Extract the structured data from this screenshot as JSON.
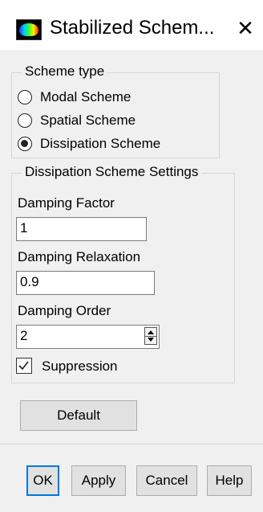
{
  "window": {
    "title": "Stabilized Schem...",
    "close_glyph": "✕",
    "icon": "fluent-app-icon"
  },
  "scheme_type": {
    "title": "Scheme type",
    "options": [
      {
        "label": "Modal Scheme",
        "checked": false
      },
      {
        "label": "Spatial Scheme",
        "checked": false
      },
      {
        "label": "Dissipation Scheme",
        "checked": true
      }
    ]
  },
  "settings": {
    "title": "Dissipation Scheme Settings",
    "damping_factor_label": "Damping Factor",
    "damping_factor_value": "1",
    "damping_relaxation_label": "Damping Relaxation",
    "damping_relaxation_value": "0.9",
    "damping_order_label": "Damping Order",
    "damping_order_value": "2",
    "suppression_label": "Suppression",
    "suppression_checked": true
  },
  "buttons": {
    "default": "Default",
    "ok": "OK",
    "apply": "Apply",
    "cancel": "Cancel",
    "help": "Help"
  },
  "colors": {
    "focus_border": "#0078d7",
    "dialog_bg": "#f0f0f0"
  }
}
